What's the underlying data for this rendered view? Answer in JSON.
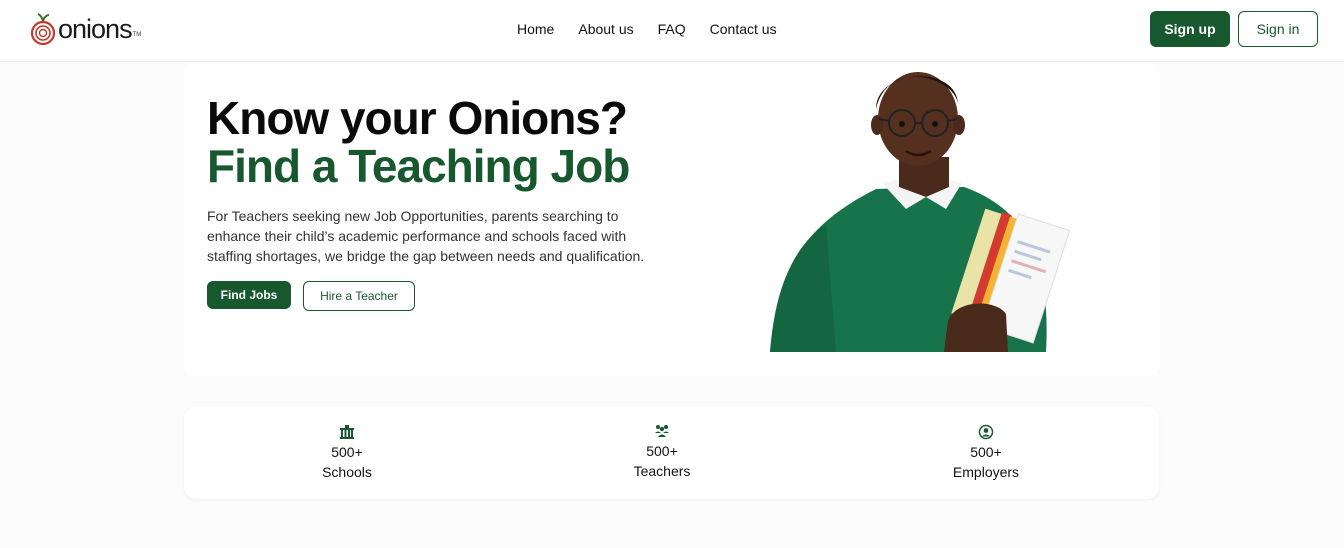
{
  "brand": {
    "name": "onions",
    "tm": "TM"
  },
  "nav": {
    "items": [
      {
        "label": "Home"
      },
      {
        "label": "About us"
      },
      {
        "label": "FAQ"
      },
      {
        "label": "Contact us"
      }
    ]
  },
  "auth": {
    "signup_label": "Sign up",
    "signin_label": "Sign in"
  },
  "hero": {
    "headline_1": "Know your Onions?",
    "headline_2": "Find a Teaching Job",
    "description": "For Teachers seeking new Job Opportunities, parents searching to enhance their child’s academic performance and schools faced with staffing shortages, we bridge the gap between needs and qualification.",
    "find_jobs_label": "Find Jobs",
    "hire_teacher_label": "Hire a Teacher"
  },
  "stats": [
    {
      "icon": "school-icon",
      "value": "500+",
      "label": "Schools"
    },
    {
      "icon": "teachers-icon",
      "value": "500+",
      "label": "Teachers"
    },
    {
      "icon": "employer-icon",
      "value": "500+",
      "label": "Employers"
    }
  ],
  "colors": {
    "brand_green": "#17582f",
    "accent_red": "#c0392b"
  }
}
